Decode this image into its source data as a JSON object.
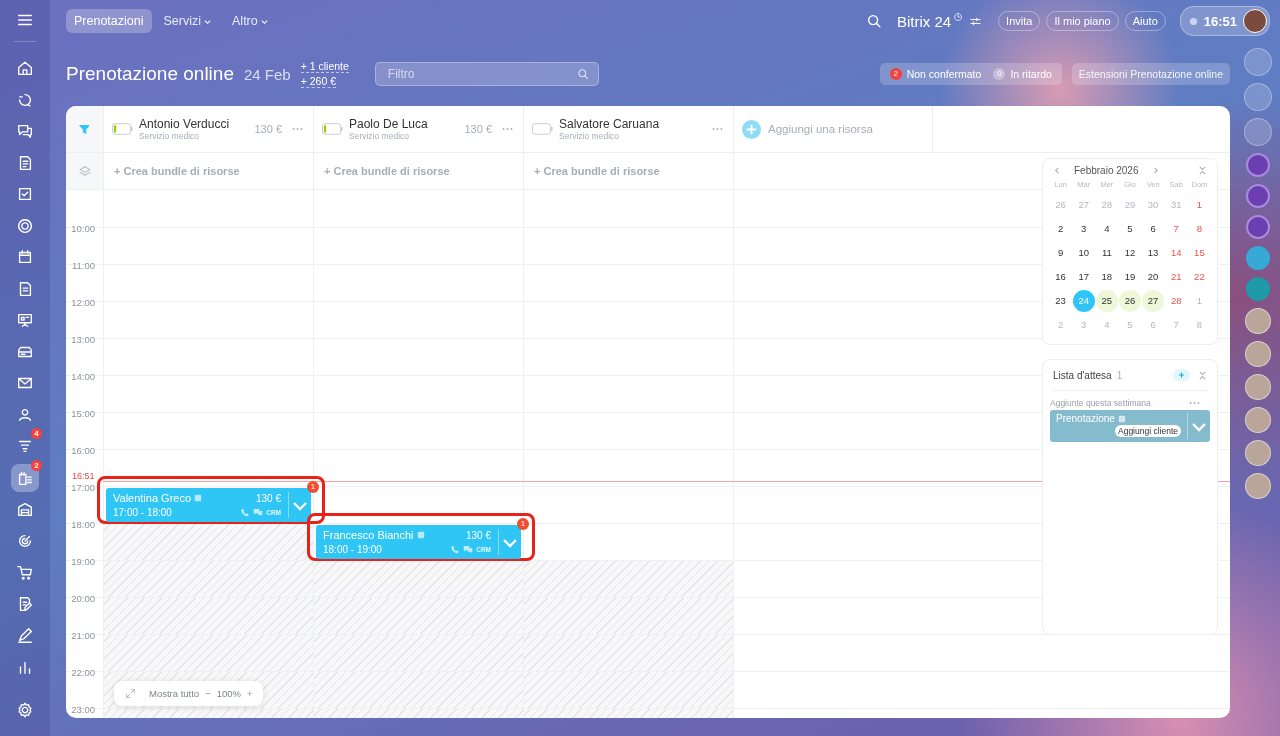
{
  "top_nav": {
    "tabs": [
      {
        "label": "Prenotazioni",
        "selected": true,
        "dropdown": false
      },
      {
        "label": "Servizi",
        "selected": false,
        "dropdown": true
      },
      {
        "label": "Altro",
        "selected": false,
        "dropdown": true
      }
    ],
    "brand": "Bitrix 24",
    "buttons": [
      "Invita",
      "Il mio piano",
      "Aiuto"
    ],
    "clock": "16:51"
  },
  "left_sidebar": {
    "items": [
      {
        "selected": false
      },
      {
        "selected": false
      },
      {
        "selected": false
      },
      {
        "selected": false
      },
      {
        "selected": false
      },
      {
        "selected": false
      },
      {
        "selected": false
      },
      {
        "selected": false
      },
      {
        "selected": false
      },
      {
        "selected": false
      },
      {
        "selected": false
      },
      {
        "selected": false
      },
      {
        "selected": false,
        "badge": "4"
      },
      {
        "selected": true,
        "badge": "2"
      },
      {
        "selected": false
      },
      {
        "selected": false
      },
      {
        "selected": false
      },
      {
        "selected": false
      },
      {
        "selected": false
      },
      {
        "selected": false
      },
      {
        "selected": false
      }
    ]
  },
  "header": {
    "title": "Prenotazione online",
    "date": "24 Feb",
    "stats": [
      "+ 1 cliente",
      "+ 260 €"
    ],
    "filter_placeholder": "Filtro",
    "counters": [
      {
        "count": "2",
        "label": "Non confermato",
        "alert": true
      },
      {
        "count": "0",
        "label": "In ritardo",
        "alert": false
      }
    ],
    "extensions_button": "Estensioni Prenotazione online"
  },
  "resources": [
    {
      "name": "Antonio Verducci",
      "type": "Servizio medico",
      "price": "130 €",
      "level": 0.15,
      "bundle": "+ Crea bundle di risorse"
    },
    {
      "name": "Paolo De Luca",
      "type": "Servizio medico",
      "price": "130 €",
      "level": 0.15,
      "bundle": "+ Crea bundle di risorse"
    },
    {
      "name": "Salvatore Caruana",
      "type": "Servizio medico",
      "level": 0,
      "bundle": "+ Crea bundle di risorse"
    }
  ],
  "add_resource": "Aggiungi una risorsa",
  "timeline": {
    "rows": [
      {
        "cells": [
          {
            "blocked": false
          },
          {
            "blocked": false
          },
          {
            "blocked": false
          }
        ]
      },
      {
        "label": "10:00",
        "cells": [
          {
            "blocked": false
          },
          {
            "blocked": false
          },
          {
            "blocked": false
          }
        ]
      },
      {
        "label": "11:00",
        "cells": [
          {
            "blocked": false
          },
          {
            "blocked": false
          },
          {
            "blocked": false
          }
        ]
      },
      {
        "label": "12:00",
        "cells": [
          {
            "blocked": false
          },
          {
            "blocked": false
          },
          {
            "blocked": false
          }
        ]
      },
      {
        "label": "13:00",
        "cells": [
          {
            "blocked": false
          },
          {
            "blocked": false
          },
          {
            "blocked": false
          }
        ]
      },
      {
        "label": "14:00",
        "cells": [
          {
            "blocked": false
          },
          {
            "blocked": false
          },
          {
            "blocked": false
          }
        ]
      },
      {
        "label": "15:00",
        "cells": [
          {
            "blocked": false
          },
          {
            "blocked": false
          },
          {
            "blocked": false
          }
        ]
      },
      {
        "label": "16:00",
        "now": "16:51",
        "cells": [
          {
            "blocked": false
          },
          {
            "blocked": false
          },
          {
            "blocked": false
          }
        ]
      },
      {
        "label": "17:00",
        "cells": [
          {
            "blocked": false,
            "booking": {
              "client": "Valentina Greco",
              "time": "17:00 - 18:00",
              "price": "130 €",
              "crm": "CRM",
              "counter": "1",
              "highlighted": true
            }
          },
          {
            "blocked": false
          },
          {
            "blocked": false
          }
        ]
      },
      {
        "label": "18:00",
        "cells": [
          {
            "blocked": true
          },
          {
            "blocked": false,
            "booking": {
              "client": "Francesco Bianchi",
              "time": "18:00 - 19:00",
              "price": "130 €",
              "crm": "CRM",
              "counter": "1",
              "highlighted": true
            }
          },
          {
            "blocked": false
          }
        ]
      },
      {
        "label": "19:00",
        "cells": [
          {
            "blocked": true
          },
          {
            "blocked": true
          },
          {
            "blocked": true
          }
        ]
      },
      {
        "label": "20:00",
        "cells": [
          {
            "blocked": true
          },
          {
            "blocked": true
          },
          {
            "blocked": true
          }
        ]
      },
      {
        "label": "21:00",
        "cells": [
          {
            "blocked": true
          },
          {
            "blocked": true
          },
          {
            "blocked": true
          }
        ]
      },
      {
        "label": "22:00",
        "cells": [
          {
            "blocked": true
          },
          {
            "blocked": true
          },
          {
            "blocked": true
          }
        ]
      },
      {
        "label": "23:00",
        "cells": [
          {
            "blocked": true
          },
          {
            "blocked": true
          },
          {
            "blocked": true
          }
        ]
      }
    ]
  },
  "zoom_control": {
    "label": "Mostra tutto",
    "minus": "−",
    "value": "100%",
    "plus": "+"
  },
  "calendar": {
    "month": "Febbraio 2026",
    "weekdays": [
      "Lun",
      "Mar",
      "Mer",
      "Gio",
      "Ven",
      "Sab",
      "Dom"
    ],
    "weeks": [
      [
        {
          "d": "26",
          "kind": "muted"
        },
        {
          "d": "27",
          "kind": "muted"
        },
        {
          "d": "28",
          "kind": "muted"
        },
        {
          "d": "29",
          "kind": "muted"
        },
        {
          "d": "30",
          "kind": "muted"
        },
        {
          "d": "31",
          "kind": "muted"
        },
        {
          "d": "1",
          "kind": "weekend"
        }
      ],
      [
        {
          "d": "2",
          "kind": "normal"
        },
        {
          "d": "3",
          "kind": "normal"
        },
        {
          "d": "4",
          "kind": "normal"
        },
        {
          "d": "5",
          "kind": "normal"
        },
        {
          "d": "6",
          "kind": "normal"
        },
        {
          "d": "7",
          "kind": "weekend"
        },
        {
          "d": "8",
          "kind": "weekend"
        }
      ],
      [
        {
          "d": "9",
          "kind": "normal"
        },
        {
          "d": "10",
          "kind": "normal"
        },
        {
          "d": "11",
          "kind": "normal"
        },
        {
          "d": "12",
          "kind": "normal"
        },
        {
          "d": "13",
          "kind": "normal"
        },
        {
          "d": "14",
          "kind": "weekend"
        },
        {
          "d": "15",
          "kind": "weekend"
        }
      ],
      [
        {
          "d": "16",
          "kind": "normal"
        },
        {
          "d": "17",
          "kind": "normal"
        },
        {
          "d": "18",
          "kind": "normal"
        },
        {
          "d": "19",
          "kind": "normal"
        },
        {
          "d": "20",
          "kind": "normal"
        },
        {
          "d": "21",
          "kind": "weekend"
        },
        {
          "d": "22",
          "kind": "weekend"
        }
      ],
      [
        {
          "d": "23",
          "kind": "normal"
        },
        {
          "d": "24",
          "kind": "selected"
        },
        {
          "d": "25",
          "kind": "marked"
        },
        {
          "d": "26",
          "kind": "marked"
        },
        {
          "d": "27",
          "kind": "marked"
        },
        {
          "d": "28",
          "kind": "weekend"
        },
        {
          "d": "1",
          "kind": "muted"
        }
      ],
      [
        {
          "d": "2",
          "kind": "muted"
        },
        {
          "d": "3",
          "kind": "muted"
        },
        {
          "d": "4",
          "kind": "muted"
        },
        {
          "d": "5",
          "kind": "muted"
        },
        {
          "d": "6",
          "kind": "muted"
        },
        {
          "d": "7",
          "kind": "muted"
        },
        {
          "d": "8",
          "kind": "muted"
        }
      ]
    ]
  },
  "waiting_list": {
    "title": "Lista d'attesa",
    "count": "1",
    "group": "Aggiunte questa settimana",
    "items": [
      {
        "title": "Prenotazione",
        "action": "Aggiungi cliente"
      }
    ]
  }
}
